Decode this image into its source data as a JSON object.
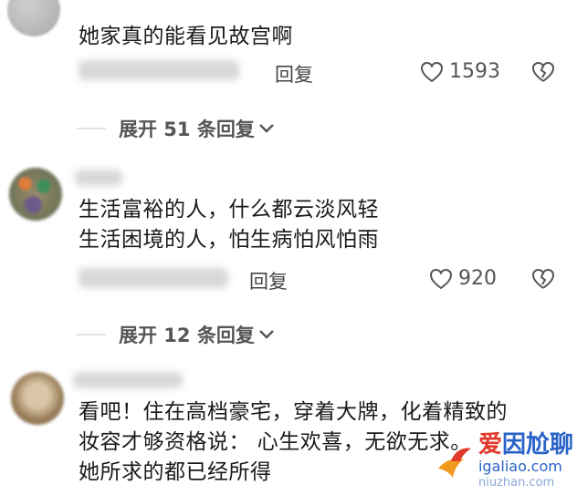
{
  "comments": [
    {
      "text_lines": [
        "她家真的能看见故宫啊"
      ],
      "reply_label": "回复",
      "likes": "1593"
    },
    {
      "text_lines": [
        "生活富裕的人，什么都云淡风轻",
        "生活困境的人，怕生病怕风怕雨"
      ],
      "reply_label": "回复",
      "likes": "920"
    },
    {
      "text_lines": [
        "看吧！住在高档豪宅，穿着大牌，化着精致的",
        "妆容才够资格说：  心生欢喜，无欲无求。",
        "她所求的都已经所得"
      ]
    }
  ],
  "expand_rows": [
    {
      "label": "展开 51 条回复"
    },
    {
      "label": "展开 12 条回复"
    }
  ],
  "watermark": {
    "brand_left": "爱",
    "brand_right": "因尬聊",
    "url": "igaliao.com",
    "sub": "niuzhan.com"
  },
  "colors": {
    "text": "#1a1a1a",
    "muted": "#555555",
    "watermark_blue": "#2a63c8",
    "watermark_red": "#e0392b"
  }
}
